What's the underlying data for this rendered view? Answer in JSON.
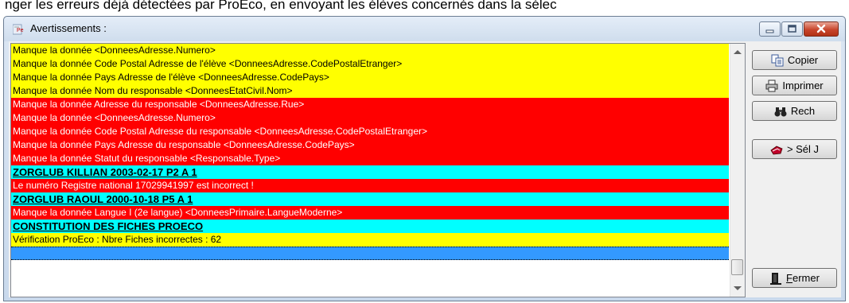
{
  "background_text": "nger les erreurs déjà détectées par ProEco, en envoyant les élèves concernés dans la sélec",
  "window": {
    "title": "Avertissements :",
    "controls": [
      "minimize",
      "maximize",
      "close"
    ]
  },
  "messages": [
    {
      "text": "Manque la donnée <DonneesAdresse.Numero>",
      "level": "yellow"
    },
    {
      "text": "Manque la donnée Code Postal Adresse de l'élève <DonneesAdresse.CodePostalEtranger>",
      "level": "yellow"
    },
    {
      "text": "Manque la donnée Pays Adresse de l'élève <DonneesAdresse.CodePays>",
      "level": "yellow"
    },
    {
      "text": "Manque la donnée Nom du responsable <DonneesEtatCivil.Nom>",
      "level": "yellow"
    },
    {
      "text": "Manque la donnée Adresse du responsable <DonneesAdresse.Rue>",
      "level": "red"
    },
    {
      "text": "Manque la donnée <DonneesAdresse.Numero>",
      "level": "red"
    },
    {
      "text": "Manque la donnée Code Postal Adresse du responsable <DonneesAdresse.CodePostalEtranger>",
      "level": "red"
    },
    {
      "text": "Manque la donnée Pays Adresse du responsable <DonneesAdresse.CodePays>",
      "level": "red"
    },
    {
      "text": "Manque la donnée Statut du responsable <Responsable.Type>",
      "level": "red"
    },
    {
      "text": "ZORGLUB KILLIAN 2003-02-17 P2 A 1",
      "level": "cyan"
    },
    {
      "text": "Le numéro Registre national 17029941997 est incorrect !",
      "level": "red"
    },
    {
      "text": "ZORGLUB RAOUL 2000-10-18 P5 A 1",
      "level": "cyan"
    },
    {
      "text": "Manque la donnée Langue I (2e langue) <DonneesPrimaire.LangueModerne>",
      "level": "red"
    },
    {
      "text": "CONSTITUTION DES FICHES PROECO",
      "level": "cyan"
    },
    {
      "text": "Vérification ProEco : Nbre Fiches incorrectes : 62",
      "level": "yellow"
    },
    {
      "text": "",
      "level": "selected"
    }
  ],
  "buttons": {
    "copy": {
      "label": "Copier",
      "icon": "copy-icon"
    },
    "print": {
      "label": "Imprimer",
      "icon": "printer-icon"
    },
    "search": {
      "label": "Rech",
      "icon": "binoculars-icon"
    },
    "select": {
      "label": "> Sél J",
      "icon": "hand-icon"
    },
    "close": {
      "label": "Fermer",
      "icon": "door-icon"
    }
  },
  "colors": {
    "warning": "#ffff00",
    "error": "#ff0000",
    "student_header": "#00ffff",
    "selection": "#3399ff"
  }
}
